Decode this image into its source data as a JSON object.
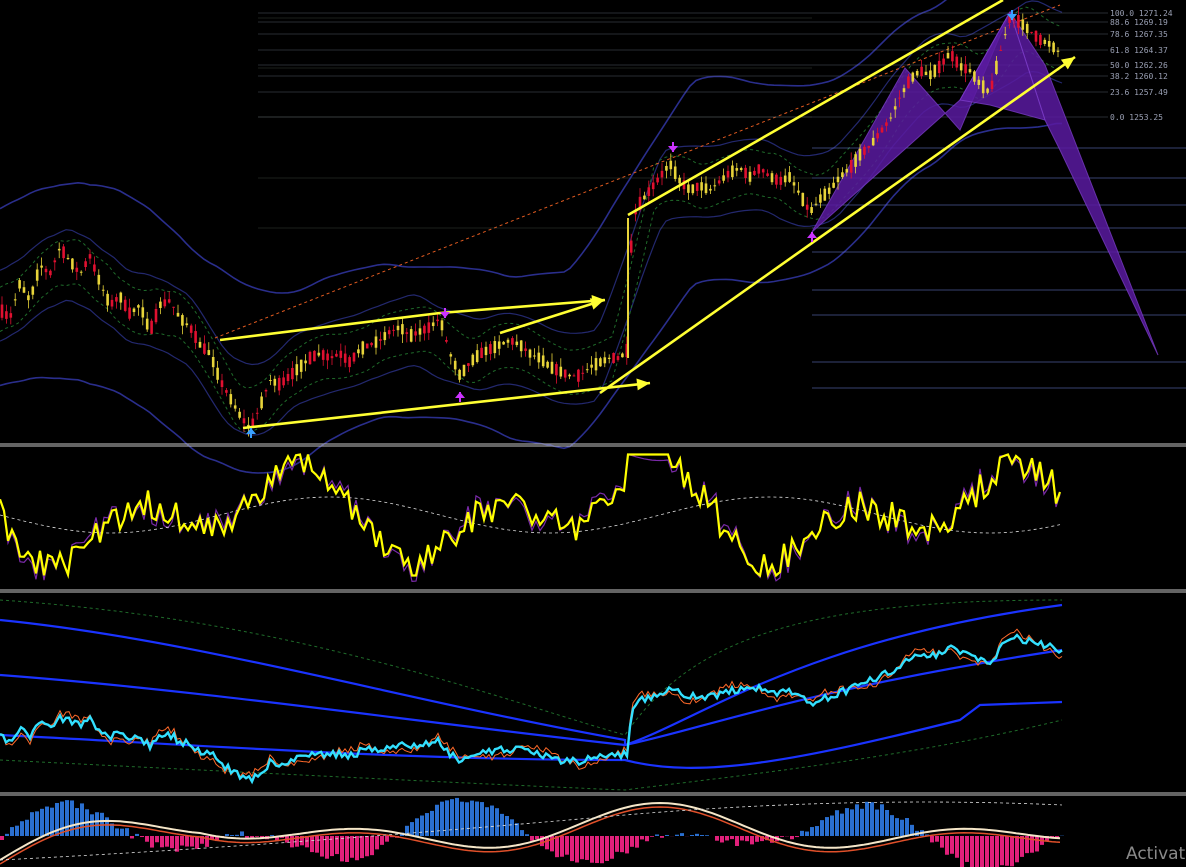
{
  "watermark": "Activat",
  "chart_data": {
    "type": "line",
    "title": "",
    "xlabel": "",
    "ylabel": "",
    "grid": false,
    "legend": "none",
    "colors": {
      "background": "#000000",
      "bull_candle": "#e8d43a",
      "bear_candle": "#e01030",
      "channel_line": "#ffff33",
      "bollinger": "#2a2e8c",
      "harmonic": "#5a1aa0",
      "oscillator": "#ffff00",
      "rsi_line": "#33e0ff",
      "histogram_up": "#2a6fd0",
      "histogram_down": "#e0207a",
      "fib_line": "#6e7fd8"
    },
    "fibonacci": {
      "levels": [
        {
          "ratio": "100.0",
          "price": "1271.24"
        },
        {
          "ratio": "88.6",
          "price": "1269.19"
        },
        {
          "ratio": "78.6",
          "price": "1267.35"
        },
        {
          "ratio": "61.8",
          "price": "1264.37"
        },
        {
          "ratio": "50.0",
          "price": "1262.26"
        },
        {
          "ratio": "38.2",
          "price": "1260.12"
        },
        {
          "ratio": "23.6",
          "price": "1257.49"
        },
        {
          "ratio": "0.0",
          "price": "1253.25"
        }
      ]
    },
    "price_path": [
      [
        0,
        0.7
      ],
      [
        10,
        0.72
      ],
      [
        20,
        0.64
      ],
      [
        30,
        0.68
      ],
      [
        40,
        0.6
      ],
      [
        50,
        0.62
      ],
      [
        60,
        0.56
      ],
      [
        70,
        0.59
      ],
      [
        80,
        0.62
      ],
      [
        90,
        0.58
      ],
      [
        100,
        0.64
      ],
      [
        110,
        0.69
      ],
      [
        120,
        0.67
      ],
      [
        130,
        0.71
      ],
      [
        140,
        0.69
      ],
      [
        150,
        0.75
      ],
      [
        160,
        0.69
      ],
      [
        170,
        0.68
      ],
      [
        180,
        0.72
      ],
      [
        190,
        0.74
      ],
      [
        200,
        0.78
      ],
      [
        210,
        0.8
      ],
      [
        220,
        0.86
      ],
      [
        230,
        0.9
      ],
      [
        240,
        0.94
      ],
      [
        250,
        0.97
      ],
      [
        260,
        0.92
      ],
      [
        270,
        0.86
      ],
      [
        280,
        0.87
      ],
      [
        290,
        0.85
      ],
      [
        300,
        0.83
      ],
      [
        310,
        0.81
      ],
      [
        320,
        0.8
      ],
      [
        330,
        0.81
      ],
      [
        340,
        0.8
      ],
      [
        350,
        0.82
      ],
      [
        360,
        0.79
      ],
      [
        370,
        0.78
      ],
      [
        380,
        0.77
      ],
      [
        390,
        0.75
      ],
      [
        400,
        0.74
      ],
      [
        410,
        0.76
      ],
      [
        420,
        0.75
      ],
      [
        430,
        0.74
      ],
      [
        440,
        0.72
      ],
      [
        450,
        0.8
      ],
      [
        460,
        0.85
      ],
      [
        470,
        0.82
      ],
      [
        480,
        0.8
      ],
      [
        490,
        0.79
      ],
      [
        500,
        0.78
      ],
      [
        510,
        0.77
      ],
      [
        520,
        0.78
      ],
      [
        530,
        0.8
      ],
      [
        540,
        0.81
      ],
      [
        550,
        0.83
      ],
      [
        560,
        0.84
      ],
      [
        570,
        0.85
      ],
      [
        580,
        0.85
      ],
      [
        590,
        0.83
      ],
      [
        600,
        0.82
      ],
      [
        610,
        0.81
      ],
      [
        620,
        0.81
      ],
      [
        628,
        0.79
      ],
      [
        632,
        0.5
      ],
      [
        640,
        0.46
      ],
      [
        650,
        0.43
      ],
      [
        660,
        0.4
      ],
      [
        670,
        0.37
      ],
      [
        680,
        0.41
      ],
      [
        690,
        0.43
      ],
      [
        700,
        0.42
      ],
      [
        710,
        0.43
      ],
      [
        720,
        0.41
      ],
      [
        730,
        0.39
      ],
      [
        740,
        0.38
      ],
      [
        750,
        0.4
      ],
      [
        760,
        0.38
      ],
      [
        770,
        0.4
      ],
      [
        780,
        0.41
      ],
      [
        790,
        0.4
      ],
      [
        800,
        0.44
      ],
      [
        810,
        0.48
      ],
      [
        820,
        0.45
      ],
      [
        830,
        0.43
      ],
      [
        840,
        0.4
      ],
      [
        850,
        0.38
      ],
      [
        860,
        0.35
      ],
      [
        870,
        0.33
      ],
      [
        880,
        0.3
      ],
      [
        890,
        0.27
      ],
      [
        900,
        0.22
      ],
      [
        910,
        0.18
      ],
      [
        920,
        0.16
      ],
      [
        930,
        0.17
      ],
      [
        940,
        0.15
      ],
      [
        950,
        0.12
      ],
      [
        960,
        0.15
      ],
      [
        970,
        0.16
      ],
      [
        980,
        0.19
      ],
      [
        990,
        0.21
      ],
      [
        1000,
        0.12
      ],
      [
        1010,
        0.04
      ],
      [
        1020,
        0.05
      ],
      [
        1030,
        0.07
      ],
      [
        1040,
        0.09
      ],
      [
        1050,
        0.1
      ],
      [
        1060,
        0.12
      ]
    ]
  }
}
